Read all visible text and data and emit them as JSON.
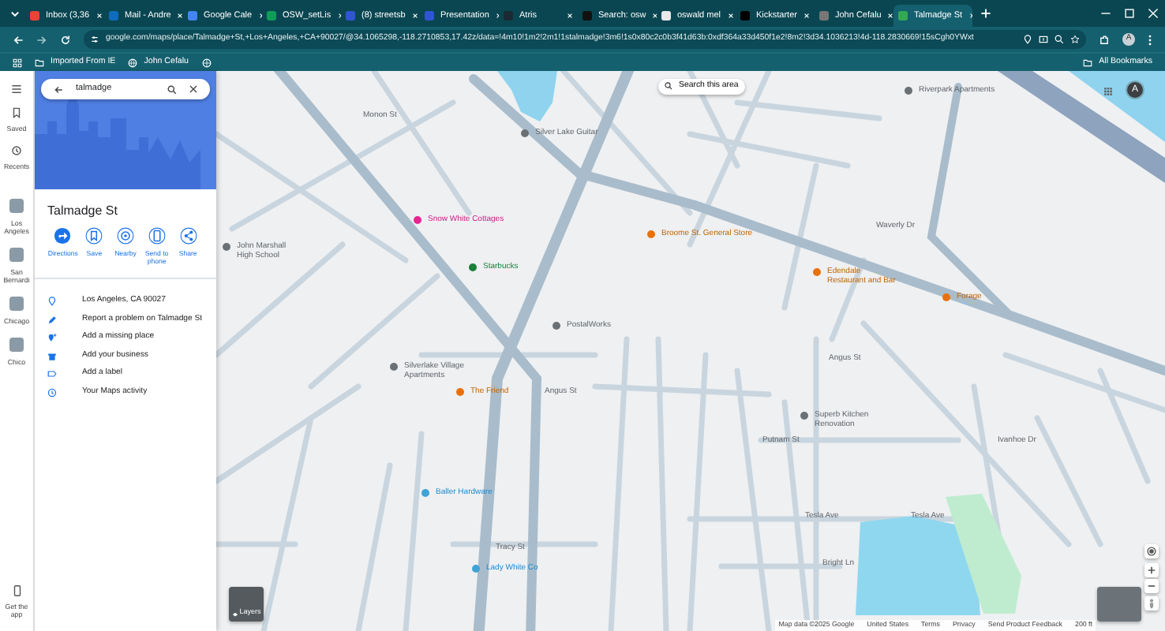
{
  "browser": {
    "tabs": [
      {
        "title": "Inbox (3,36",
        "selected": false,
        "color": "#ea4335"
      },
      {
        "title": "Mail - Andre",
        "selected": false,
        "color": "#0f6cbd"
      },
      {
        "title": "Google Cale",
        "selected": false,
        "color": "#4285f4"
      },
      {
        "title": "OSW_setLis",
        "selected": false,
        "color": "#0f9d58"
      },
      {
        "title": "(8) streetsb",
        "selected": false,
        "color": "#2f55d4"
      },
      {
        "title": "Presentation",
        "selected": false,
        "color": "#2f55d4"
      },
      {
        "title": "Atris",
        "selected": false,
        "color": "#1b2a33"
      },
      {
        "title": "Search: osw",
        "selected": false,
        "color": "#111111"
      },
      {
        "title": "oswald mel",
        "selected": false,
        "color": "#e8e8e8"
      },
      {
        "title": "Kickstarter",
        "selected": false,
        "color": "#000000"
      },
      {
        "title": "John Cefalu",
        "selected": false,
        "color": "#777777"
      },
      {
        "title": "Talmadge St",
        "selected": true,
        "color": "#34a853"
      }
    ],
    "url": "google.com/maps/place/Talmadge+St,+Los+Angeles,+CA+90027/@34.1065298,-118.2710853,17.42z/data=!4m10!1m2!2m1!1stalmadge!3m6!1s0x80c2c0b3f41d63b:0xdf364a33d450f1e2!8m2!3d34.1036213!4d-118.2830669!15sCgh0YWxt",
    "profile_initial": "A",
    "bookmarks": [
      "Imported From IE",
      "John Cefalu"
    ],
    "all_bookmarks": "All Bookmarks"
  },
  "rail": {
    "items": [
      {
        "label": "Saved",
        "kind": "saved"
      },
      {
        "label": "Recents",
        "kind": "recents"
      },
      {
        "label": "Los Angeles",
        "kind": "place"
      },
      {
        "label": "San Bernardi",
        "kind": "place"
      },
      {
        "label": "Chicago",
        "kind": "place"
      },
      {
        "label": "Chico",
        "kind": "place"
      }
    ],
    "get_app": "Get the app"
  },
  "panel": {
    "search": {
      "value": "talmadge"
    },
    "title": "Talmadge St",
    "actions": [
      {
        "label": "Directions",
        "kind": "directions"
      },
      {
        "label": "Save",
        "kind": "save"
      },
      {
        "label": "Nearby",
        "kind": "nearby"
      },
      {
        "label": "Send to phone",
        "kind": "send"
      },
      {
        "label": "Share",
        "kind": "share"
      }
    ],
    "details": [
      {
        "text": "Los Angeles, CA 90027",
        "kind": "address"
      },
      {
        "text": "Report a problem on Talmadge St",
        "kind": "report"
      },
      {
        "text": "Add a missing place",
        "kind": "add-place"
      },
      {
        "text": "Add your business",
        "kind": "business"
      },
      {
        "text": "Add a label",
        "kind": "label"
      },
      {
        "text": "Your Maps activity",
        "kind": "activity"
      }
    ]
  },
  "map": {
    "search_area": "Search this area",
    "account_initial": "A",
    "labels": [
      {
        "text": "Monon St",
        "kind": "street"
      },
      {
        "text": "Silver Lake Guitar",
        "kind": "poi"
      },
      {
        "text": "Snow White Cottages",
        "kind": "shopping"
      },
      {
        "text": "Starbucks",
        "kind": "cafe"
      },
      {
        "text": "John Marshall High School",
        "kind": "poi"
      },
      {
        "text": "PostalWorks",
        "kind": "poi"
      },
      {
        "text": "Silverlake Village Apartments",
        "kind": "poi"
      },
      {
        "text": "The Friend",
        "kind": "food"
      },
      {
        "text": "Broome St. General Store",
        "kind": "food"
      },
      {
        "text": "Riverpark Apartments",
        "kind": "poi"
      },
      {
        "text": "Edendale Restaurant and Bar",
        "kind": "food"
      },
      {
        "text": "Forage",
        "kind": "food"
      },
      {
        "text": "Waverly Dr",
        "kind": "street"
      },
      {
        "text": "Angus St",
        "kind": "street"
      },
      {
        "text": "Angus St",
        "kind": "street"
      },
      {
        "text": "Putnam St",
        "kind": "street"
      },
      {
        "text": "Tesla Ave",
        "kind": "street"
      },
      {
        "text": "Tesla Ave",
        "kind": "street"
      },
      {
        "text": "Bright Ln",
        "kind": "street"
      },
      {
        "text": "Tracy St",
        "kind": "street"
      },
      {
        "text": "Baller Hardware",
        "kind": "store"
      },
      {
        "text": "Lady White Co",
        "kind": "store"
      },
      {
        "text": "Superb Kitchen Renovation",
        "kind": "poi"
      },
      {
        "text": "Ivanhoe Dr",
        "kind": "street"
      }
    ],
    "layers": "Layers",
    "attribution": [
      "Map data ©2025 Google",
      "United States",
      "Terms",
      "Privacy",
      "Send Product Feedback",
      "200 ft"
    ]
  }
}
